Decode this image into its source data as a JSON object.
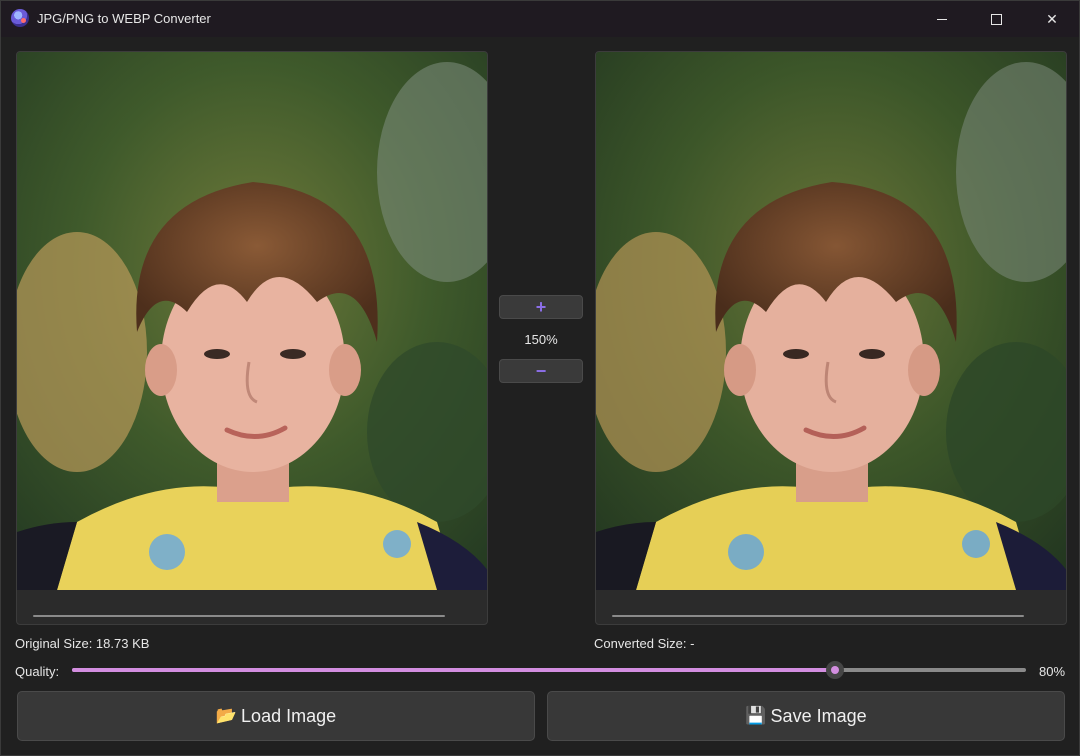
{
  "window": {
    "title": "JPG/PNG to WEBP Converter",
    "controls": {
      "minimize": "minimize",
      "maximize": "maximize",
      "close": "✕"
    }
  },
  "zoom": {
    "plus_label": "+",
    "minus_label": "−",
    "level": "150%"
  },
  "original": {
    "size_label": "Original Size: 18.73 KB"
  },
  "converted": {
    "size_label": "Converted Size: -"
  },
  "quality": {
    "label": "Quality:",
    "value": 80,
    "value_text": "80%",
    "min": 0,
    "max": 100
  },
  "buttons": {
    "load": {
      "icon": "📂",
      "label": "Load Image",
      "icon_name": "folder-icon"
    },
    "save": {
      "icon": "💾",
      "label": "Save Image",
      "icon_name": "floppy-disk-icon"
    }
  },
  "colors": {
    "accent": "#d38ee0",
    "zoom_glyph": "#8b6ee6",
    "background": "#202020"
  }
}
